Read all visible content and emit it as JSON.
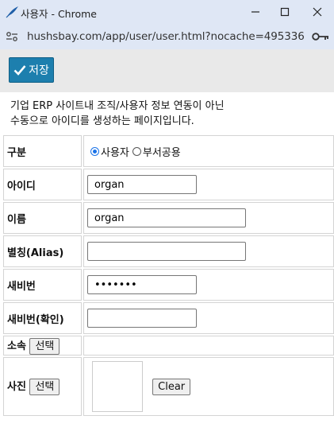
{
  "window": {
    "title": "사용자 - Chrome"
  },
  "address": {
    "url": "hushsbay.com/app/user/user.html?nocache=495336"
  },
  "toolbar": {
    "save_label": "저장"
  },
  "notice": {
    "line1": "기업 ERP 사이트내 조직/사용자 정보 연동이 아닌",
    "line2": "수동으로 아이디를 생성하는 페이지입니다."
  },
  "form": {
    "type_label": "구분",
    "type_options": [
      "사용자",
      "부서공용"
    ],
    "type_selected": "사용자",
    "id_label": "아이디",
    "id_value": "organ",
    "name_label": "이름",
    "name_value": "organ",
    "alias_label": "별칭(Alias)",
    "alias_value": "",
    "pw_label": "새비번",
    "pw_value": "•••••••",
    "pw_confirm_label": "새비번(확인)",
    "pw_confirm_value": "",
    "dept_label": "소속",
    "dept_select_label": "선택",
    "photo_label": "사진",
    "photo_select_label": "선택",
    "photo_clear_label": "Clear"
  },
  "colors": {
    "titlebar": "#dfe7f5",
    "save_button": "#1d7fae",
    "radio_accent": "#1a73e8"
  },
  "icons": {
    "app": "feather-icon",
    "site_info": "tune-icon",
    "password_key": "key-icon",
    "save": "check-icon"
  }
}
